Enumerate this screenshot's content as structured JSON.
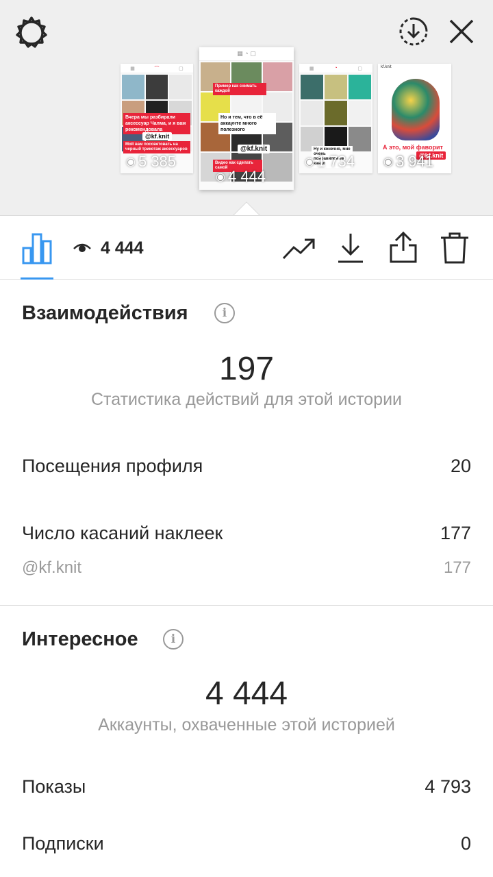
{
  "stories": [
    {
      "views": "5 385",
      "caption": "Вчера мы разбирали аксессуар Чалма, и я вам рекомендовала",
      "tag": "@kf.knit",
      "caption2": "Мой вам посоветовать на черный трикотаж аксессуаров"
    },
    {
      "views": "4 444",
      "caption": "Но и тем, что в её аккаунте много полезного",
      "tag": "@kf.knit",
      "caption2": "Видео как сделать самой",
      "top_caption": "Пример как снимать каждой"
    },
    {
      "views": "1 734",
      "caption": "Ну и конечно, мне очень понравился ее канал",
      "tag": ""
    },
    {
      "views": "3 941",
      "caption": "А это, мой фаворит",
      "tag": "@kf.knit",
      "account": "kf.knit"
    }
  ],
  "toolbar": {
    "views": "4 444"
  },
  "interactions": {
    "title": "Взаимодействия",
    "total": "197",
    "caption": "Статистика действий для этой истории",
    "rows": [
      {
        "label": "Посещения профиля",
        "value": "20"
      },
      {
        "label": "Число касаний наклеек",
        "value": "177"
      }
    ],
    "sub_row": {
      "label": "@kf.knit",
      "value": "177"
    }
  },
  "discovery": {
    "title": "Интересное",
    "total": "4 444",
    "caption": "Аккаунты, охваченные этой историей",
    "rows": [
      {
        "label": "Показы",
        "value": "4 793"
      },
      {
        "label": "Подписки",
        "value": "0"
      }
    ]
  },
  "colors": {
    "accent": "#3897f0",
    "text": "#262626",
    "muted": "#999999",
    "divider": "#dbdbdb",
    "top_bg": "#efefef",
    "story_red": "#e8243a"
  },
  "icons": {
    "settings": "gear-icon",
    "download_circle": "download-circle-icon",
    "close": "close-icon",
    "chart": "bar-chart-icon",
    "eye": "eye-icon",
    "trend": "trend-icon",
    "download": "download-icon",
    "share": "share-icon",
    "trash": "trash-icon",
    "info": "info-icon"
  }
}
